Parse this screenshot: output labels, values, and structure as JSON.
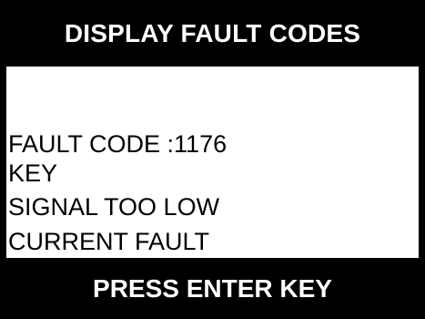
{
  "header": {
    "title": "DISPLAY FAULT CODES"
  },
  "fault": {
    "code_line": "FAULT CODE :1176",
    "component": "KEY",
    "description": "SIGNAL TOO LOW",
    "status": "CURRENT FAULT"
  },
  "footer": {
    "prompt": "PRESS ENTER KEY"
  },
  "colors": {
    "background": "#000000",
    "panel": "#ffffff",
    "text_dark": "#000000",
    "text_light": "#ffffff"
  }
}
